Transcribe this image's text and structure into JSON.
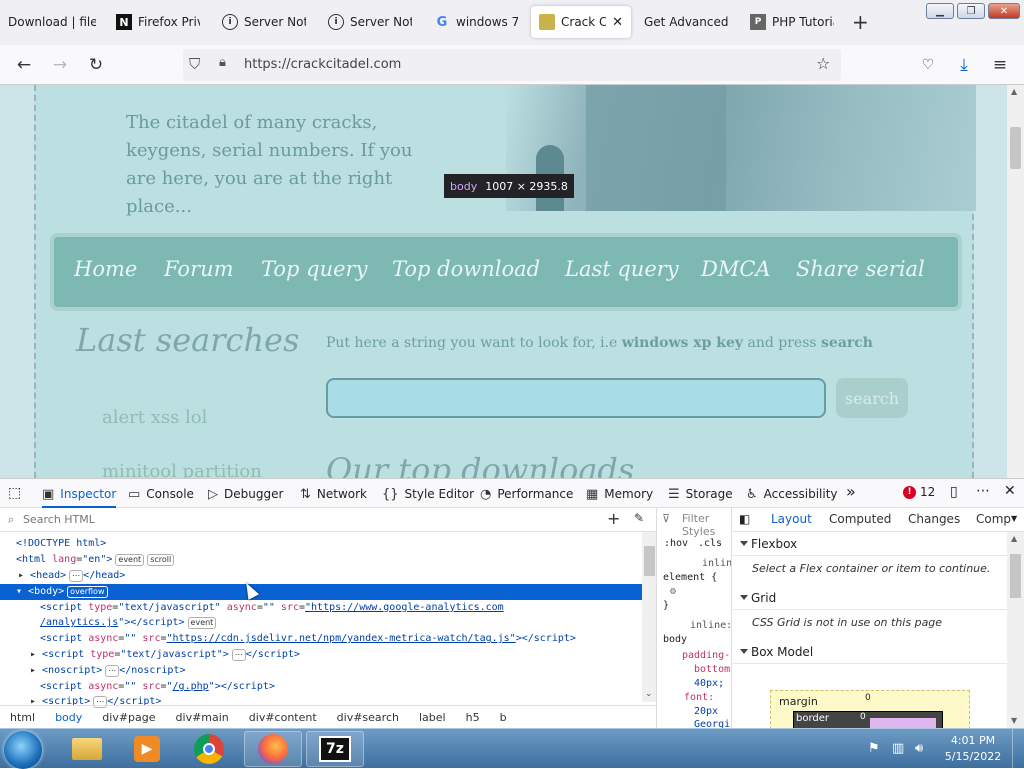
{
  "browser": {
    "tabs": [
      {
        "title": "Download | file",
        "icon": "download-icon"
      },
      {
        "title": "Firefox Privacy",
        "icon": "notion-icon"
      },
      {
        "title": "Server Not Found",
        "icon": "info-icon"
      },
      {
        "title": "Server Not Found",
        "icon": "info-icon"
      },
      {
        "title": "windows 7",
        "icon": "google-icon"
      },
      {
        "title": "Crack Citadel",
        "icon": "citadel-icon",
        "active": true
      },
      {
        "title": "Get Advanced B",
        "icon": "none"
      },
      {
        "title": "PHP Tutorial",
        "icon": "php-icon"
      }
    ],
    "url": "https://crackcitadel.com",
    "element_tooltip": {
      "tag": "body",
      "size": "1007 × 2935.8"
    }
  },
  "page": {
    "tagline": "The citadel of many cracks, keygens, serial numbers. If you are here, you are at the right place...",
    "menu": [
      "Home",
      "Forum",
      "Top query",
      "Top download",
      "Last query",
      "DMCA",
      "Share serial"
    ],
    "last_searches_title": "Last searches",
    "last_searches": [
      "alert xss lol",
      "minitool partition"
    ],
    "search_prompt_pre": "Put here a string you want to look for, i.e",
    "search_prompt_example": "windows xp key",
    "search_prompt_mid": "and press",
    "search_prompt_action": "search",
    "search_button": "search",
    "top_downloads_title": "Our top downloads"
  },
  "devtools": {
    "tabs": [
      "Inspector",
      "Console",
      "Debugger",
      "Network",
      "Style Editor",
      "Performance",
      "Memory",
      "Storage",
      "Accessibility"
    ],
    "active_tab": "Inspector",
    "error_count": "12",
    "search_placeholder": "Search HTML",
    "filter_placeholder": "Filter Styles",
    "breadcrumbs": [
      "html",
      "body",
      "div#page",
      "div#main",
      "div#content",
      "div#search",
      "label",
      "h5",
      "b"
    ],
    "rules": {
      "hov": ":hov",
      "cls": ".cls",
      "inline1": "inline",
      "element": "element {",
      "close1": "}",
      "inline2": "inline:",
      "body_sel": "body",
      "padding": "padding-",
      "bottom": "bottom",
      "px40": "40px;",
      "font": "font:",
      "px20": "20px",
      "georgia": "Georgi"
    },
    "layout_tabs": [
      "Layout",
      "Computed",
      "Changes",
      "Comp"
    ],
    "flexbox_title": "Flexbox",
    "flexbox_note": "Select a Flex container or item to continue.",
    "grid_title": "Grid",
    "grid_note": "CSS Grid is not in use on this page",
    "boxmodel_title": "Box Model",
    "boxmodel_margin": "margin",
    "boxmodel_border": "border",
    "boxmodel_zero": "0"
  },
  "taskbar": {
    "time": "4:01 PM",
    "date": "5/15/2022"
  }
}
